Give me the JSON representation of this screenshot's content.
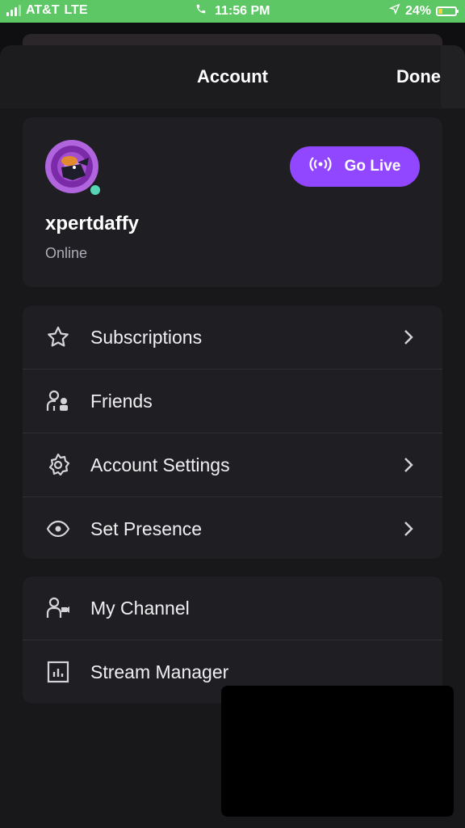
{
  "status_bar": {
    "carrier": "AT&T",
    "network": "LTE",
    "time": "11:56 PM",
    "battery_percent": "24%",
    "battery_level": 0.24,
    "background_color": "#5ec765"
  },
  "header": {
    "title": "Account",
    "done_label": "Done"
  },
  "profile": {
    "username": "xpertdaffy",
    "status": "Online",
    "go_live_label": "Go Live",
    "accent_color": "#9147ff",
    "online_color": "#57d6b5"
  },
  "menu": {
    "section1": [
      {
        "label": "Subscriptions",
        "icon": "star-icon",
        "chevron": true
      },
      {
        "label": "Friends",
        "icon": "friends-icon",
        "chevron": false
      },
      {
        "label": "Account Settings",
        "icon": "gear-icon",
        "chevron": true
      },
      {
        "label": "Set Presence",
        "icon": "eye-icon",
        "chevron": true
      }
    ],
    "section2": [
      {
        "label": "My Channel",
        "icon": "channel-icon",
        "chevron": false
      },
      {
        "label": "Stream Manager",
        "icon": "stream-manager-icon",
        "chevron": false
      }
    ]
  }
}
